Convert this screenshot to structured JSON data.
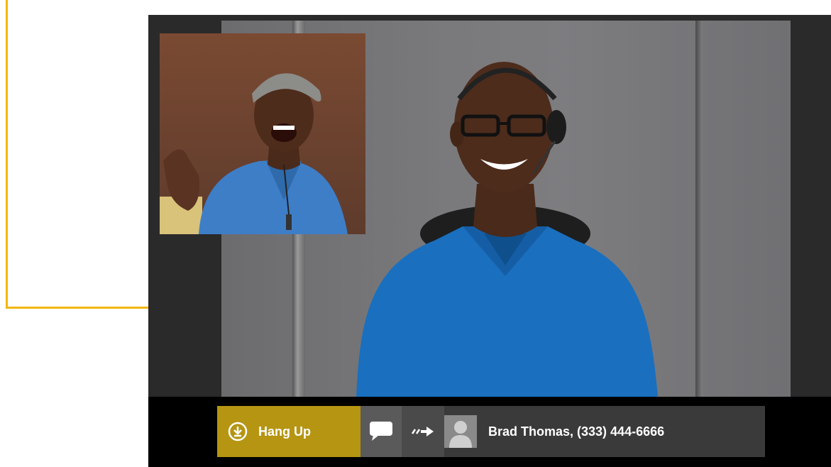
{
  "call": {
    "hangup_label": "Hang Up",
    "contact_display": "Brad Thomas, (333) 444-6666"
  },
  "icons": {
    "hangup": "download-circle-icon",
    "chat": "chat-bubble-icon",
    "transfer": "transfer-arrow-icon",
    "avatar": "person-silhouette-icon"
  },
  "colors": {
    "callout": "#f2b705",
    "hangup_bg": "#b59512",
    "toolbar_bg": "#000000",
    "call_bar_bg": "#3a3a3a"
  }
}
